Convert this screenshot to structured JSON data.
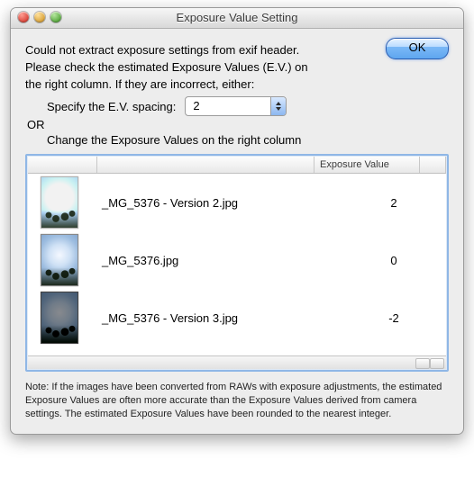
{
  "window": {
    "title": "Exposure Value Setting"
  },
  "messages": {
    "error": "Could not extract exposure settings from exif header.",
    "instruction1": "Please check the estimated Exposure Values (E.V.) on",
    "instruction2": "the right column. If they are incorrect, either:",
    "specify_label": "Specify the E.V. spacing:",
    "or_label": "OR",
    "change_label": "Change the Exposure Values on the right column"
  },
  "buttons": {
    "ok": "OK"
  },
  "ev_select": {
    "value": "2"
  },
  "table": {
    "headers": {
      "thumb": "",
      "name": "",
      "ev": "Exposure Value"
    },
    "rows": [
      {
        "thumb_variant": "bright",
        "filename": "_MG_5376 - Version 2.jpg",
        "ev": "2"
      },
      {
        "thumb_variant": "",
        "filename": "_MG_5376.jpg",
        "ev": "0"
      },
      {
        "thumb_variant": "dark",
        "filename": "_MG_5376 - Version 3.jpg",
        "ev": "-2"
      }
    ]
  },
  "note": "Note: If the images have been converted from RAWs with exposure adjustments, the estimated Exposure Values are often more accurate than the Exposure Values derived from camera settings. The estimated Exposure Values have been rounded to the nearest integer."
}
